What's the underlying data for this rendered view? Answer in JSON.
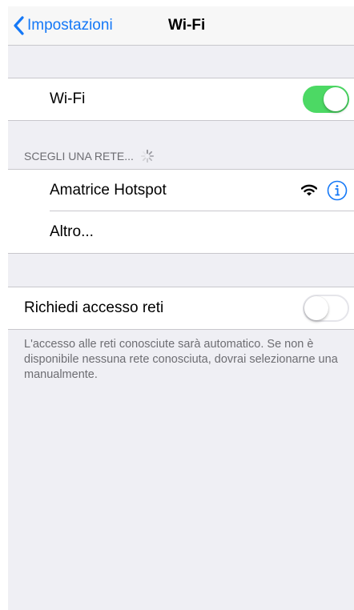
{
  "nav": {
    "back_label": "Impostazioni",
    "title": "Wi-Fi",
    "back_icon": "chevron-left-icon"
  },
  "wifi": {
    "label": "Wi-Fi",
    "enabled": true
  },
  "networks": {
    "header": "SCEGLI UNA RETE...",
    "items": [
      {
        "name": "Amatrice Hotspot",
        "icons": [
          "wifi-signal-icon",
          "info-icon"
        ]
      },
      {
        "name": "Altro..."
      }
    ]
  },
  "ask_to_join": {
    "label": "Richiedi accesso reti",
    "enabled": false,
    "footer": "L'accesso alle reti conosciute sarà automatico. Se non è disponibile nessuna rete conosciuta, dovrai selezionarne una manualmente."
  },
  "colors": {
    "accent": "#1478f7",
    "toggle_on": "#4cd964",
    "background": "#efeff4",
    "secondary_text": "#6d6d72"
  }
}
